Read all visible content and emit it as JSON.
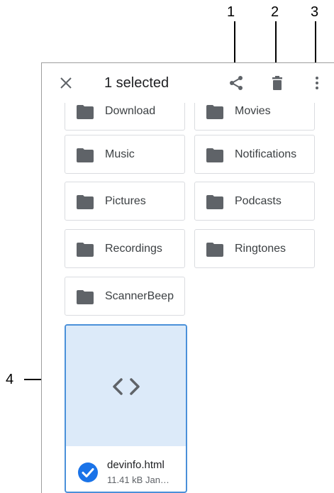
{
  "appbar": {
    "title": "1 selected",
    "close_icon": "close-icon",
    "share_icon": "share-icon",
    "delete_icon": "delete-icon",
    "more_icon": "more-vert-icon"
  },
  "folders": [
    {
      "label": "Download"
    },
    {
      "label": "Movies"
    },
    {
      "label": "Music"
    },
    {
      "label": "Notifications"
    },
    {
      "label": "Pictures"
    },
    {
      "label": "Podcasts"
    },
    {
      "label": "Recordings"
    },
    {
      "label": "Ringtones"
    },
    {
      "label": "ScannerBeep"
    }
  ],
  "file": {
    "name": "devinfo.html",
    "meta": "11.41 kB Jan…",
    "selected": true,
    "icon": "code-icon"
  },
  "callouts": [
    "1",
    "2",
    "3",
    "4"
  ],
  "colors": {
    "selection_bg": "#dceaf9",
    "selection_border": "#4a90d9",
    "check": "#1a73e8",
    "folder": "#5f6368"
  }
}
